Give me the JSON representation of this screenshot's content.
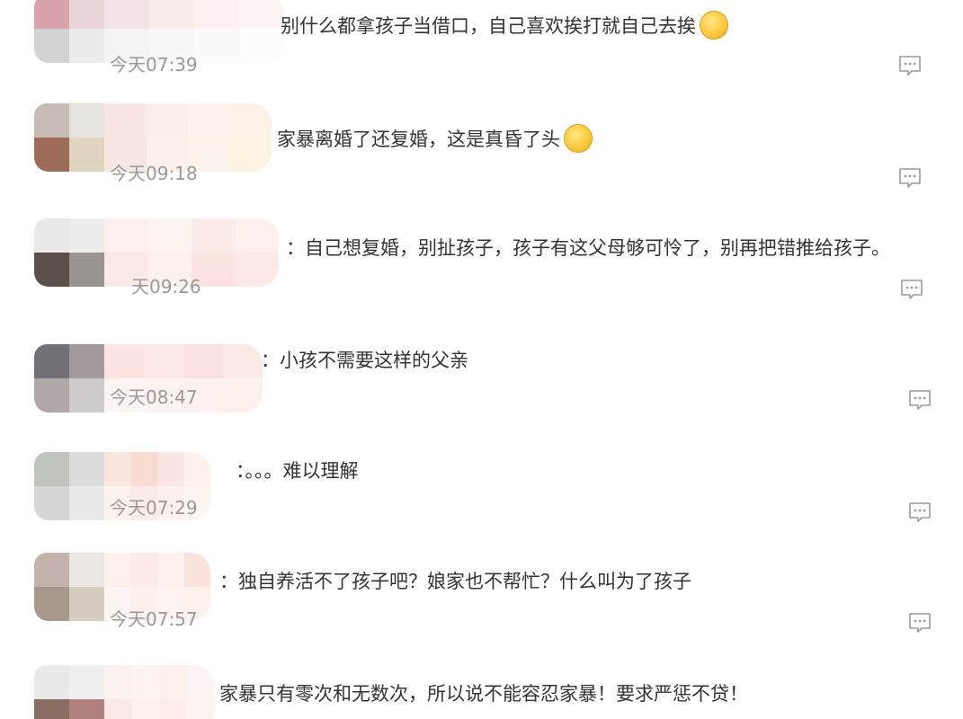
{
  "comments": [
    {
      "avatar_tiles": [
        "#d9a3ae",
        "#e8d6da",
        "#d3d3d3",
        "#ececec"
      ],
      "name_tiles": [
        "#f3e3e4",
        "#f8ebea",
        "#fbf0ef",
        "#fdf5f4",
        "#f4f4f4",
        "#f7f7f7",
        "#fafafa",
        "#fcfcfc"
      ],
      "text": "别什么都拿孩子当借口，自己喜欢挨打就自己去挨",
      "emoji": "drooling-emoji",
      "timestamp": "今天07:39"
    },
    {
      "avatar_tiles": [
        "#c8bdb6",
        "#e6e3df",
        "#9c6c58",
        "#e2d5c0"
      ],
      "name_tiles": [
        "#fae7e3",
        "#fbeeea",
        "#fdf2ee",
        "#fdf0e6",
        "#f8e6e2",
        "#fbefe9",
        "#fcf3ea",
        "#fdf3e3"
      ],
      "text": "家暴离婚了还复婚，这是真昏了头",
      "emoji": "cold-sweat-emoji",
      "timestamp": "今天09:18"
    },
    {
      "avatar_tiles": [
        "#e9e9e9",
        "#ededed",
        "#5a4f4b",
        "#999490"
      ],
      "name_tiles": [
        "#fcefee",
        "#fdf3f1",
        "#fbebe9",
        "#fdf0ee",
        "#fbe9e6",
        "#fdf1ee",
        "#fde4e1",
        "#fdeae6"
      ],
      "text": "：自己想复婚，别扯孩子，孩子有这父母够可怜了，别再把错推给孩子。",
      "emoji": "",
      "timestamp": "天09:26"
    },
    {
      "avatar_tiles": [
        "#737077",
        "#a29a9c",
        "#b1a8aa",
        "#cfcbcd"
      ],
      "name_tiles": [
        "#fde4e0",
        "#fce8e4",
        "#fce3df",
        "#fdeae4",
        "#fdf5f3",
        "#fdf3f0",
        "#fdf2ef",
        "#fcf0ed"
      ],
      "text": "：小孩不需要这样的父亲",
      "emoji": "",
      "timestamp": "今天08:47"
    },
    {
      "avatar_tiles": [
        "#bfc4bd",
        "#dcdcdc",
        "#d6d6d6",
        "#e9e9e9"
      ],
      "name_tiles": [
        "#fbe5df",
        "#f9dbd4",
        "#fae7e1",
        "#fdf1ed",
        "#fdf2ee",
        "#fbece8",
        "#fcf1ee",
        "#fdf5f2"
      ],
      "text": "：。。。难以理解",
      "emoji": "",
      "timestamp": "今天07:29"
    },
    {
      "avatar_tiles": [
        "#c4b2ac",
        "#ebe8e4",
        "#a8978a",
        "#d4cbc1"
      ],
      "name_tiles": [
        "#fdf0ec",
        "#fcebe7",
        "#fdefeb",
        "#fbe3dd",
        "#fdf5f3",
        "#fcf0ed",
        "#fdf3f0",
        "#fdf1ee"
      ],
      "text": "：独自养活不了孩子吧？娘家也不帮忙？什么叫为了孩子",
      "emoji": "",
      "timestamp": "今天07:57"
    },
    {
      "avatar_tiles": [
        "#e9e9e9",
        "#efefef",
        "#8a6e66",
        "#b07f80"
      ],
      "name_tiles": [
        "#fcf1ee",
        "#fdf4f2",
        "#fcefec",
        "#fdf5f3",
        "#fbe9e6",
        "#fdf0ed",
        "#fcedea",
        "#fdf3f0"
      ],
      "text": "家暴只有零次和无数次，所以说不能容忍家暴！要求严惩不贷！",
      "emoji": "",
      "timestamp": ""
    }
  ],
  "reply_icon": "comment-bubble-icon",
  "colors": {
    "text": "#333333",
    "timestamp": "#999999",
    "icon": "#9a9a9a"
  }
}
